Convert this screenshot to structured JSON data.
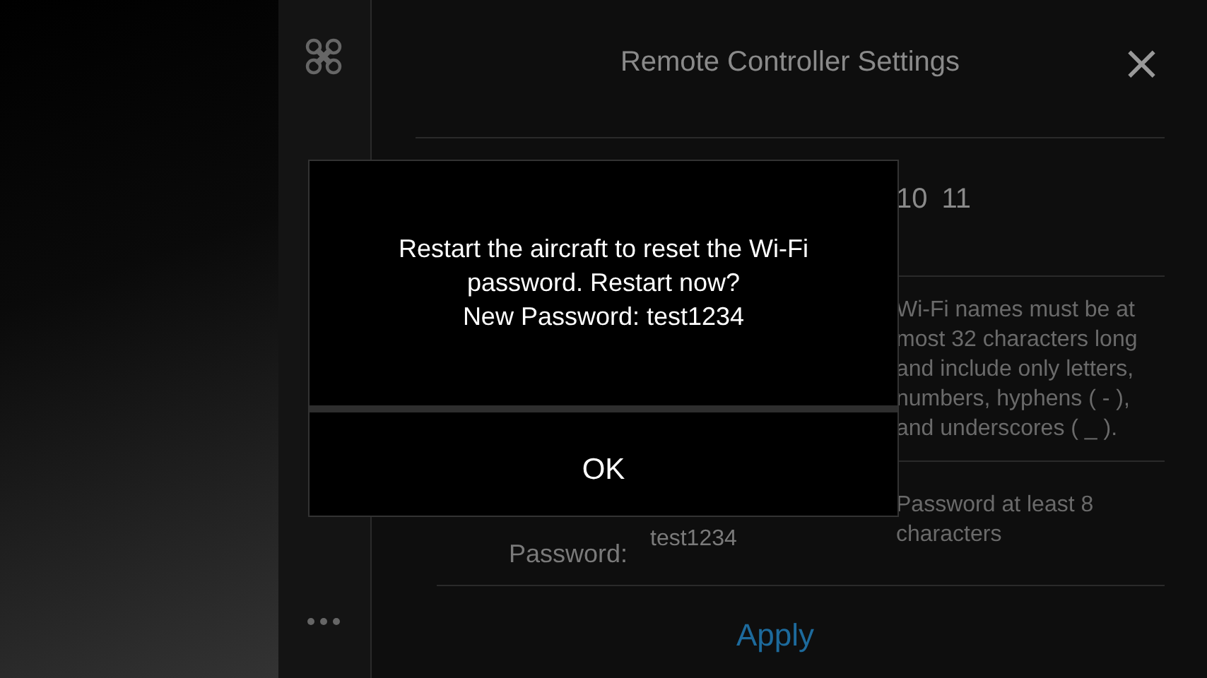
{
  "sidebar": {
    "items": [
      {
        "kind": "drone",
        "selected": false
      },
      {
        "kind": "more",
        "selected": false
      }
    ]
  },
  "panel": {
    "title": "Remote Controller Settings",
    "close": "×",
    "channel_index": {
      "channels": [
        "10",
        "11"
      ]
    },
    "fields": [
      {
        "hint": "Wi-Fi names must be at most 32 characters long and include only letters, numbers, hyphens ( - ), and underscores ( _ )."
      },
      {
        "label": "Password:",
        "value": "test1234",
        "hint": "Password at least 8 characters"
      }
    ],
    "apply": "Apply"
  },
  "dialog": {
    "message": "Restart the aircraft to reset the Wi-Fi password. Restart now?\nNew Password: test1234",
    "button": "OK"
  }
}
